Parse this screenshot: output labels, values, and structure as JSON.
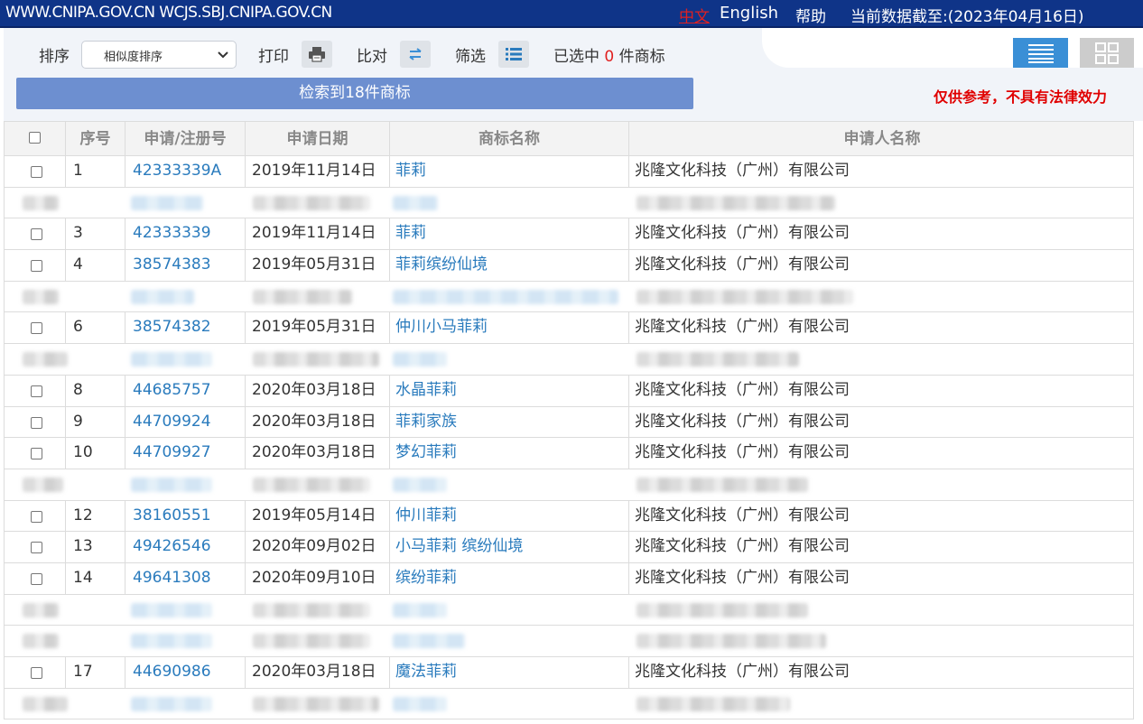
{
  "topbar": {
    "site": "WWW.CNIPA.GOV.CN WCJS.SBJ.CNIPA.GOV.CN",
    "lang_cn": "中文",
    "lang_en": "English",
    "help": "帮助",
    "data_date": "当前数据截至:(2023年04月16日)"
  },
  "toolbar": {
    "sort_label": "排序",
    "sort_value": "相似度排序",
    "print_label": "打印",
    "compare_label": "比对",
    "filter_label": "筛选",
    "selected_prefix": "已选中",
    "selected_count": "0",
    "selected_suffix": "件商标",
    "print_icon": "printer-icon",
    "compare_icon": "compare-arrows-icon",
    "filter_icon": "list-filter-icon"
  },
  "results_label": "检索到18件商标",
  "disclaimer": "仅供参考，不具有法律效力",
  "colors": {
    "topbar": "#0f3488",
    "link": "#2a7bbd",
    "accent": "#e02020",
    "result_bar": "#6d8fd0",
    "view_active": "#3a8fd6"
  },
  "table": {
    "headers": {
      "seq": "序号",
      "reg_no": "申请/注册号",
      "date": "申请日期",
      "name": "商标名称",
      "applicant": "申请人名称"
    },
    "rows": [
      {
        "seq": "1",
        "reg_no": "42333339A",
        "date": "2019年11月14日",
        "name": "菲莉",
        "applicant": "兆隆文化科技（广州）有限公司"
      },
      {
        "seq": "3",
        "reg_no": "42333339",
        "date": "2019年11月14日",
        "name": "菲莉",
        "applicant": "兆隆文化科技（广州）有限公司"
      },
      {
        "seq": "4",
        "reg_no": "38574383",
        "date": "2019年05月31日",
        "name": "菲莉缤纷仙境",
        "applicant": "兆隆文化科技（广州）有限公司"
      },
      {
        "seq": "6",
        "reg_no": "38574382",
        "date": "2019年05月31日",
        "name": "仲川小马菲莉",
        "applicant": "兆隆文化科技（广州）有限公司"
      },
      {
        "seq": "8",
        "reg_no": "44685757",
        "date": "2020年03月18日",
        "name": "水晶菲莉",
        "applicant": "兆隆文化科技（广州）有限公司"
      },
      {
        "seq": "9",
        "reg_no": "44709924",
        "date": "2020年03月18日",
        "name": "菲莉家族",
        "applicant": "兆隆文化科技（广州）有限公司"
      },
      {
        "seq": "10",
        "reg_no": "44709927",
        "date": "2020年03月18日",
        "name": "梦幻菲莉",
        "applicant": "兆隆文化科技（广州）有限公司"
      },
      {
        "seq": "12",
        "reg_no": "38160551",
        "date": "2019年05月14日",
        "name": "仲川菲莉",
        "applicant": "兆隆文化科技（广州）有限公司"
      },
      {
        "seq": "13",
        "reg_no": "49426546",
        "date": "2020年09月02日",
        "name": "小马菲莉 缤纷仙境",
        "applicant": "兆隆文化科技（广州）有限公司"
      },
      {
        "seq": "14",
        "reg_no": "49641308",
        "date": "2020年09月10日",
        "name": "缤纷菲莉",
        "applicant": "兆隆文化科技（广州）有限公司"
      },
      {
        "seq": "17",
        "reg_no": "44690986",
        "date": "2020年03月18日",
        "name": "魔法菲莉",
        "applicant": "兆隆文化科技（广州）有限公司"
      }
    ]
  }
}
